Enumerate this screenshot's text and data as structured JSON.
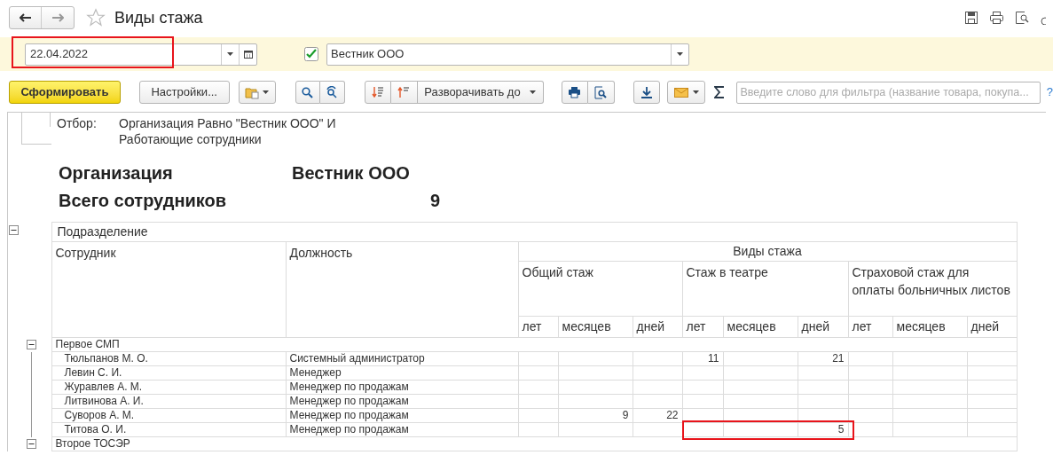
{
  "window": {
    "title": "Виды стажа"
  },
  "filter_bar": {
    "date": {
      "value": "22.04.2022",
      "highlighted": true
    },
    "organization": {
      "checked": true,
      "value": "Вестник ООО"
    }
  },
  "toolbar": {
    "generate_button": "Сформировать",
    "settings_button": "Настройки...",
    "expand_button": "Разворачивать до",
    "filter": {
      "placeholder": "Введите слово для фильтра (название товара, покупа..."
    },
    "help": "?"
  },
  "report": {
    "filter_label": "Отбор:",
    "filter_lines": [
      "Организация Равно \"Вестник ООО\" И",
      "Работающие сотрудники"
    ],
    "summary": [
      {
        "kind": "text",
        "label": "Организация",
        "value": "Вестник ООО"
      },
      {
        "kind": "number",
        "label": "Всего сотрудников",
        "value": "9"
      }
    ],
    "expanded": true,
    "header": {
      "row_group_label": "Подразделение",
      "columns": [
        "Сотрудник",
        "Должность"
      ],
      "measure_group": "Виды стажа",
      "measures": [
        {
          "title": "Общий стаж",
          "units": [
            "лет",
            "месяцев",
            "дней"
          ]
        },
        {
          "title": "Стаж в театре",
          "units": [
            "лет",
            "месяцев",
            "дней"
          ]
        },
        {
          "title": "Страховой стаж для оплаты больничных листов",
          "units": [
            "лет",
            "месяцев",
            "дней"
          ]
        }
      ]
    },
    "groups": [
      {
        "name": "Первое СМП",
        "expanded": true,
        "rows": [
          {
            "employee": "Тюльпанов М. О.",
            "position": "Системный администратор",
            "theater": {
              "years": "11",
              "days": "21"
            },
            "theater_highlighted": false
          },
          {
            "employee": "Левин С. И.",
            "position": "Менеджер",
            "theater_highlighted": false
          },
          {
            "employee": "Журавлев А. М.",
            "position": "Менеджер по продажам",
            "theater_highlighted": false
          },
          {
            "employee": "Литвинова А. И.",
            "position": "Менеджер по продажам",
            "theater_highlighted": false
          },
          {
            "employee": "Суворов А. М.",
            "position": "Менеджер по продажам",
            "general": {
              "months": "9",
              "days": "22"
            },
            "theater_highlighted": false
          },
          {
            "employee": "Титова О. И.",
            "position": "Менеджер по продажам",
            "theater": {
              "days": "5"
            },
            "theater_highlighted": true
          }
        ]
      },
      {
        "name": "Второе ТОСЭР",
        "expanded": true
      }
    ]
  }
}
